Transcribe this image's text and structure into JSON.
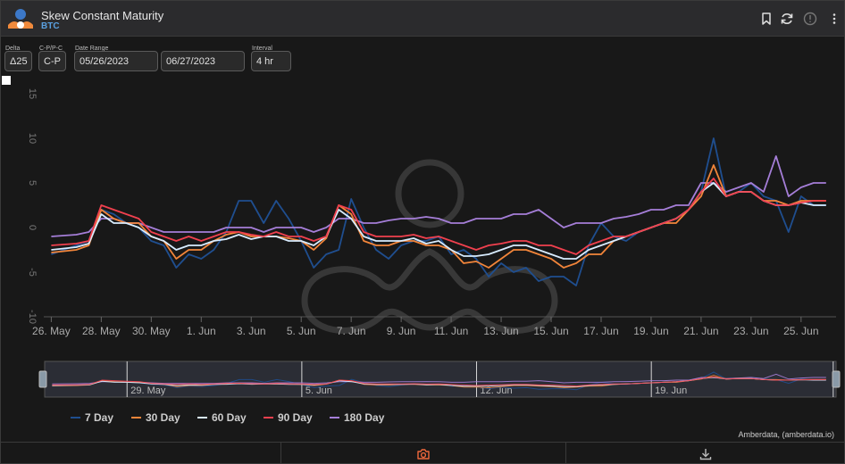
{
  "header": {
    "title": "Skew Constant Maturity",
    "subtitle": "BTC"
  },
  "controls": [
    {
      "label": "Delta",
      "value": "Δ25"
    },
    {
      "label": "C-P/P-C",
      "value": "C-P"
    },
    {
      "label": "Date Range",
      "value": "05/26/2023"
    },
    {
      "label": "",
      "value": "06/27/2023"
    },
    {
      "label": "Interval",
      "value": "4 hr"
    }
  ],
  "credit": "Amberdata, (amberdata.io)",
  "colors": {
    "7 Day": "#1f4e8f",
    "30 Day": "#f2853a",
    "60 Day": "#d8ecff",
    "90 Day": "#f0404e",
    "180 Day": "#a57ed8"
  },
  "chart_data": {
    "type": "line",
    "title": "",
    "xlabel": "",
    "ylabel": "",
    "ylim": [
      -10,
      15
    ],
    "yticks": [
      "-10",
      "-5",
      "0",
      "5",
      "10",
      "15"
    ],
    "x_tick_labels": [
      "26. May",
      "28. May",
      "30. May",
      "1. Jun",
      "3. Jun",
      "5. Jun",
      "7. Jun",
      "9. Jun",
      "11. Jun",
      "13. Jun",
      "15. Jun",
      "17. Jun",
      "19. Jun",
      "21. Jun",
      "23. Jun",
      "25. Jun"
    ],
    "x_tick_day_offsets": [
      0,
      2,
      4,
      6,
      8,
      10,
      12,
      14,
      16,
      18,
      20,
      22,
      24,
      26,
      28,
      30
    ],
    "x_range_day_offsets": [
      -0.3,
      31.4
    ],
    "navigator_tick_labels": [
      "29. May",
      "5. Jun",
      "12. Jun",
      "19. Jun"
    ],
    "navigator_tick_day_offsets": [
      3,
      10,
      17,
      24
    ],
    "grid": false,
    "legend_position": "bottom-left",
    "x": [
      0,
      1,
      1.5,
      2,
      2.5,
      3,
      3.5,
      4,
      4.5,
      5,
      5.5,
      6,
      6.5,
      7,
      7.5,
      8,
      8.5,
      9,
      9.5,
      10,
      10.5,
      11,
      11.5,
      12,
      12.5,
      13,
      13.5,
      14,
      14.5,
      15,
      15.5,
      16,
      16.5,
      17,
      17.5,
      18,
      18.5,
      19,
      19.5,
      20,
      20.5,
      21,
      21.5,
      22,
      22.5,
      23,
      23.5,
      24,
      24.5,
      25,
      25.5,
      26,
      26.5,
      27,
      27.5,
      28,
      28.5,
      29,
      29.5,
      30,
      30.5,
      31
    ],
    "series": [
      {
        "name": "7 Day",
        "values": [
          -3,
          -2,
          -1.5,
          2,
          1.5,
          0.5,
          0,
          -1.5,
          -2,
          -4.5,
          -3,
          -3.5,
          -2.5,
          -0.5,
          3,
          3,
          0.5,
          3,
          1,
          -1.5,
          -4.5,
          -3,
          -2.5,
          3.2,
          0,
          -2.5,
          -3.5,
          -2,
          -1.5,
          -1.5,
          -1,
          -3,
          -2.5,
          -3.5,
          -5.5,
          -4,
          -5,
          -4.5,
          -6,
          -5.5,
          -5.5,
          -6.5,
          -2,
          0.5,
          -1,
          -1.5,
          -0.5,
          0,
          0.5,
          1,
          2,
          4,
          10,
          3.5,
          4,
          5,
          3.5,
          3,
          -0.5,
          3.5,
          2.5,
          2.5
        ]
      },
      {
        "name": "30 Day",
        "values": [
          -2.8,
          -2.5,
          -2,
          2,
          1,
          0.5,
          0.5,
          -1,
          -1.5,
          -3.5,
          -2.5,
          -2.5,
          -1.5,
          -0.8,
          -0.5,
          -1,
          -1,
          -1,
          -1.2,
          -1.5,
          -2.5,
          -1.2,
          2.5,
          1.5,
          -1.5,
          -2,
          -2,
          -1.5,
          -1.5,
          -2,
          -2,
          -2.5,
          -4,
          -3.8,
          -4.5,
          -3.5,
          -2.5,
          -2.5,
          -3,
          -3.5,
          -4.5,
          -4,
          -3,
          -3,
          -1.5,
          -1,
          -0.5,
          0,
          0.5,
          0.5,
          2,
          3.5,
          7,
          3.5,
          4,
          4,
          3,
          3,
          2.5,
          3,
          3,
          3
        ]
      },
      {
        "name": "60 Day",
        "values": [
          -2.5,
          -2.2,
          -1.8,
          1.5,
          0.5,
          0.5,
          0,
          -1,
          -1.5,
          -2.5,
          -2,
          -2,
          -1.5,
          -1.3,
          -0.8,
          -1.3,
          -1,
          -1,
          -1.5,
          -1.5,
          -2,
          -1,
          2,
          1,
          -1,
          -1.5,
          -1.5,
          -1.5,
          -1.2,
          -1.8,
          -1.5,
          -2.5,
          -3.2,
          -3.2,
          -3,
          -2.5,
          -2,
          -2,
          -2.5,
          -3,
          -3.5,
          -3.5,
          -2.5,
          -2,
          -1.5,
          -1,
          -0.5,
          0,
          0.5,
          1,
          2,
          4,
          5,
          3.5,
          4,
          4,
          3,
          2.5,
          2.5,
          2.8,
          2.5,
          2.5
        ]
      },
      {
        "name": "90 Day",
        "values": [
          -2,
          -1.8,
          -1.5,
          2.5,
          2,
          1.5,
          1,
          -0.5,
          -1,
          -1.5,
          -1,
          -1.5,
          -1,
          -0.5,
          -0.5,
          -0.8,
          -1,
          -0.5,
          -1,
          -1,
          -1.5,
          -1,
          2.5,
          2,
          -0.5,
          -1,
          -1,
          -1,
          -0.8,
          -1.2,
          -1,
          -1.5,
          -2,
          -2.5,
          -2,
          -1.8,
          -1.5,
          -1.5,
          -2,
          -2,
          -2.5,
          -3,
          -2,
          -1.5,
          -1,
          -1,
          -0.5,
          0,
          0.5,
          1,
          2,
          4,
          5.5,
          3.5,
          4,
          4,
          3,
          2.5,
          2.5,
          2.8,
          3,
          3
        ]
      },
      {
        "name": "180 Day",
        "values": [
          -1,
          -0.8,
          -0.5,
          1,
          1,
          0.5,
          0.5,
          0,
          -0.5,
          -0.5,
          -0.5,
          -0.5,
          -0.5,
          0,
          0,
          0,
          -0.5,
          0,
          0,
          0,
          -0.5,
          0,
          1,
          1,
          0.5,
          0.5,
          0.8,
          1,
          1,
          1.2,
          1,
          0.5,
          0.5,
          1,
          1,
          1,
          1.5,
          1.5,
          2,
          1,
          0,
          0.5,
          0.5,
          0.5,
          1,
          1.2,
          1.5,
          2,
          2,
          2.5,
          2.5,
          5,
          5,
          4,
          4.5,
          5,
          4,
          8,
          3.5,
          4.5,
          5,
          5
        ]
      }
    ]
  }
}
